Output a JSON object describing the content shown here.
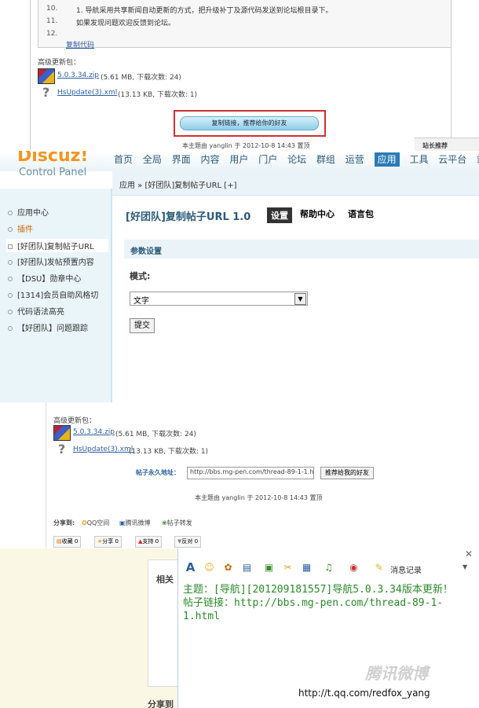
{
  "section1": {
    "lines": [
      {
        "num": "10.",
        "text": "1. 导航采用共享新闻自动更新的方式，把升级补丁及源代码发送到论坛根目录下。"
      },
      {
        "num": "11.",
        "text": "如果发现问题欢迎反馈到论坛。"
      },
      {
        "num": "12.",
        "text": ""
      }
    ],
    "copy_code": "复制代码",
    "attach_title": "高级更新包：",
    "files": [
      {
        "name": "5.0.3.34.zip",
        "meta": "(5.61 MB, 下载次数: 24)"
      },
      {
        "name": "HsUpdate(3).xml",
        "meta": "(13.13 KB, 下载次数: 1)"
      }
    ],
    "highlight_button": "复制链接，推荐给你的好友",
    "footer_text": "本主题由 yanglin 于 2012-10-8 14:43 置顶",
    "corner_label": "站长推荐"
  },
  "section2": {
    "logo": "Discuz!",
    "logo_sub": "Control Panel",
    "nav": [
      "首页",
      "全局",
      "界面",
      "内容",
      "用户",
      "门户",
      "论坛",
      "群组",
      "运营",
      "应用",
      "工具",
      "云平台",
      "站长"
    ],
    "nav_active": "应用",
    "breadcrumb": "应用 » [好团队]复制帖子URL [+]",
    "sidebar": [
      "应用中心",
      "插件",
      "[好团队]复制帖子URL",
      "[好团队]发帖预置内容",
      "【DSU】勋章中心",
      "[1314]会员自助风格切",
      "代码语法高亮",
      "【好团队】问题跟踪"
    ],
    "plugin_title": "[好团队]复制帖子URL 1.0",
    "tabs": [
      "设置",
      "帮助中心",
      "语言包"
    ],
    "section_title": "参数设置",
    "mode_label": "模式:",
    "mode_value": "文字",
    "submit_label": "提交"
  },
  "section3": {
    "attach_title": "高级更新包：",
    "files": [
      {
        "name": "5.0.3.34.zip",
        "meta": "(5.61 MB, 下载次数: 24)"
      },
      {
        "name": "HsUpdate(3).xml",
        "meta": "(13.13 KB, 下载次数: 1)"
      }
    ],
    "perma_label": "帖子永久地址：",
    "perma_value": "http://bbs.mg-pen.com/thread-89-1-1.h",
    "copy_button": "推荐给我的好友",
    "footer_text": "本主题由 yanglin 于 2012-10-8 14:43 置顶",
    "share_label": "分享到:",
    "share_items": [
      "QQ空间",
      "腾讯微博",
      "帖子转发"
    ],
    "actions": [
      "收藏 0",
      "分享 0",
      "支持 0",
      "反对 0"
    ]
  },
  "section4": {
    "related": "相关",
    "share": "分享到",
    "history_label": "消息记录",
    "message_line1": "主题：[导航][201209181557]导航5.0.3.34版本更新！",
    "message_line2": "帖子链接：http://bbs.mg-pen.com/thread-89-1-1.html",
    "watermark": "腾讯微博",
    "watermark_url": "http://t.qq.com/redfox_yang"
  }
}
